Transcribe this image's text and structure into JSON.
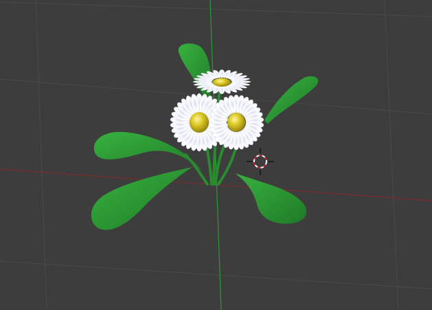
{
  "viewport": {
    "background": "#3d3d3d",
    "grid_color": "#4a4a4a",
    "axis_x_color": "#7a2b2b",
    "axis_y_color": "#2f9a35"
  },
  "scene": {
    "object": "daisy-plant",
    "leaf_color": "#2c9a34",
    "petal_color": "#ffffff",
    "center_color": "#c9b81a"
  },
  "cursor": {
    "icon": "3d-cursor-icon",
    "ring_colors": [
      "#ffffff",
      "#cc2222"
    ]
  }
}
